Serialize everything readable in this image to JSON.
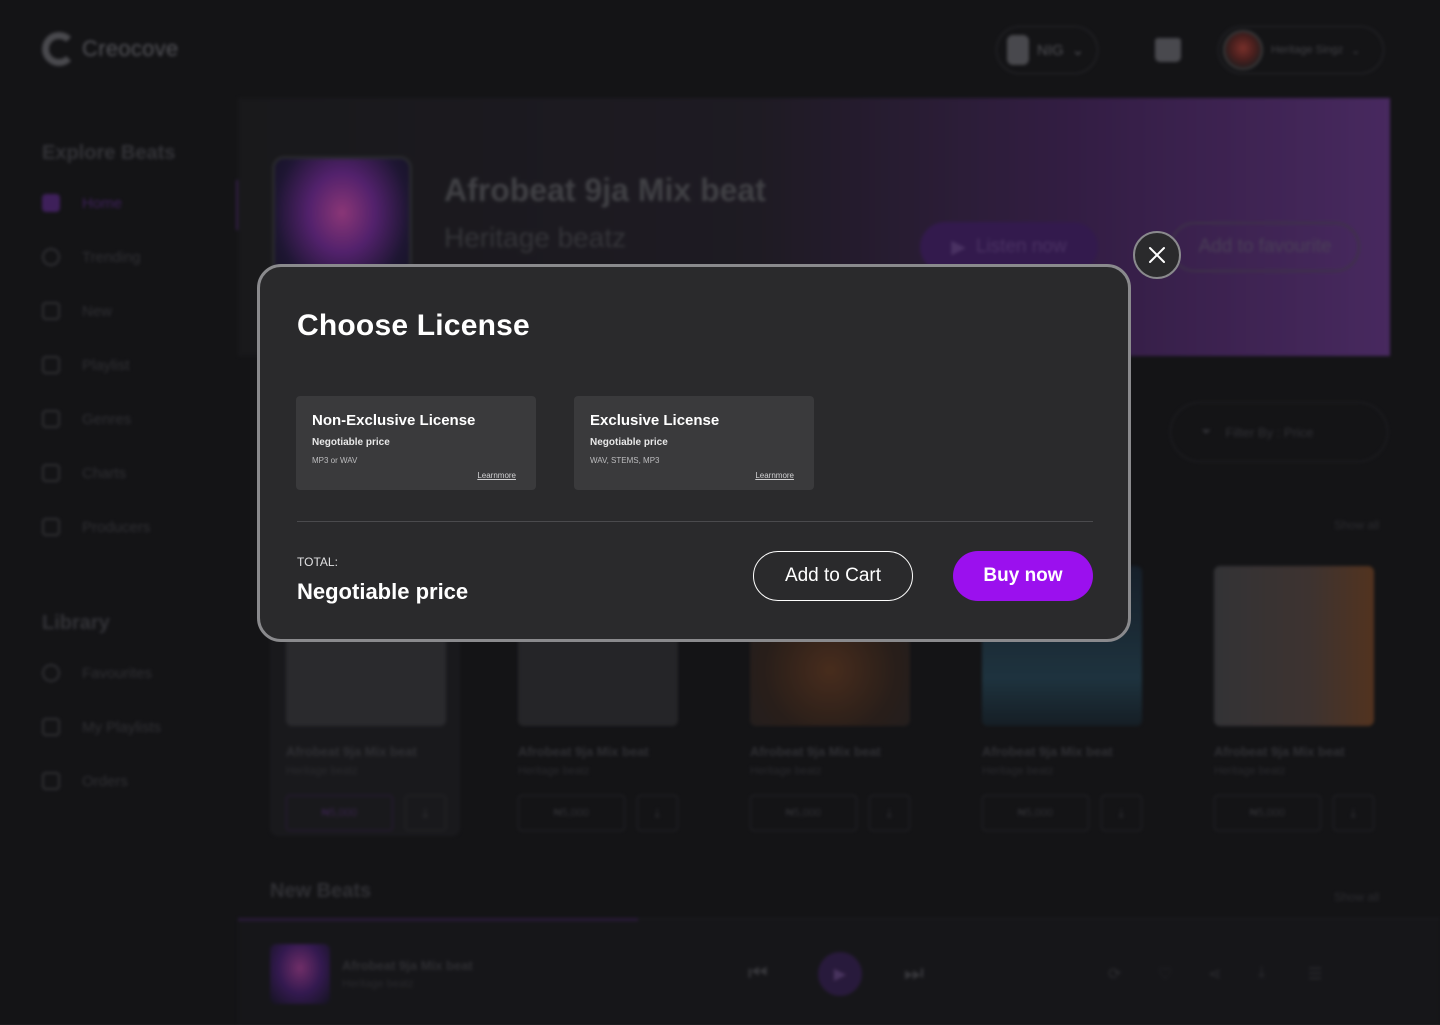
{
  "brand": {
    "name": "Creocove"
  },
  "header": {
    "country": "NIG",
    "username": "Heritage Singz"
  },
  "sidebar": {
    "explore_heading": "Explore Beats",
    "items": [
      {
        "label": "Home",
        "icon": "grid-icon"
      },
      {
        "label": "Trending",
        "icon": "check-circle-icon"
      },
      {
        "label": "New",
        "icon": "new-icon"
      },
      {
        "label": "Playlist",
        "icon": "playlist-icon"
      },
      {
        "label": "Genres",
        "icon": "genres-icon"
      },
      {
        "label": "Charts",
        "icon": "chart-icon"
      },
      {
        "label": "Producers",
        "icon": "producer-icon"
      }
    ],
    "library_heading": "Library",
    "library_items": [
      {
        "label": "Favourites",
        "icon": "heart-icon"
      },
      {
        "label": "My Playlists",
        "icon": "headphones-icon"
      },
      {
        "label": "Orders",
        "icon": "cart-icon"
      }
    ]
  },
  "hero": {
    "title": "Afrobeat 9ja Mix beat",
    "artist": "Heritage beatz",
    "listen_label": "Listen now",
    "favourite_label": "Add to favourite"
  },
  "filter": {
    "label": "Filter By : Price"
  },
  "sections": {
    "show_all": "Show all",
    "new_beats": "New Beats"
  },
  "cards": [
    {
      "title": "Afrobeat 9ja Mix beat",
      "artist": "Heritage beatz",
      "price": "₦5,000"
    },
    {
      "title": "Afrobeat 9ja Mix beat",
      "artist": "Heritage beatz",
      "price": "₦5,000"
    },
    {
      "title": "Afrobeat 9ja Mix beat",
      "artist": "Heritage beatz",
      "price": "₦5,000"
    },
    {
      "title": "Afrobeat 9ja Mix beat",
      "artist": "Heritage beatz",
      "price": "₦5,000"
    },
    {
      "title": "Afrobeat 9ja Mix beat",
      "artist": "Heritage beatz",
      "price": "₦5,000"
    }
  ],
  "player": {
    "title": "Afrobeat 9ja Mix beat",
    "artist": "Heritage beatz"
  },
  "modal": {
    "title": "Choose License",
    "licenses": [
      {
        "name": "Non-Exclusive License",
        "price": "Negotiable price",
        "formats": "MP3 or WAV",
        "learn_more": "Learnmore"
      },
      {
        "name": "Exclusive License",
        "price": "Negotiable price",
        "formats": "WAV, STEMS, MP3",
        "learn_more": "Learnmore"
      }
    ],
    "total_label": "TOTAL:",
    "total_value": "Negotiable price",
    "add_to_cart": "Add to Cart",
    "buy_now": "Buy now"
  },
  "colors": {
    "accent": "#9b10ee",
    "modal_bg": "#2a2a2c",
    "card_bg": "#3a3a3c"
  }
}
